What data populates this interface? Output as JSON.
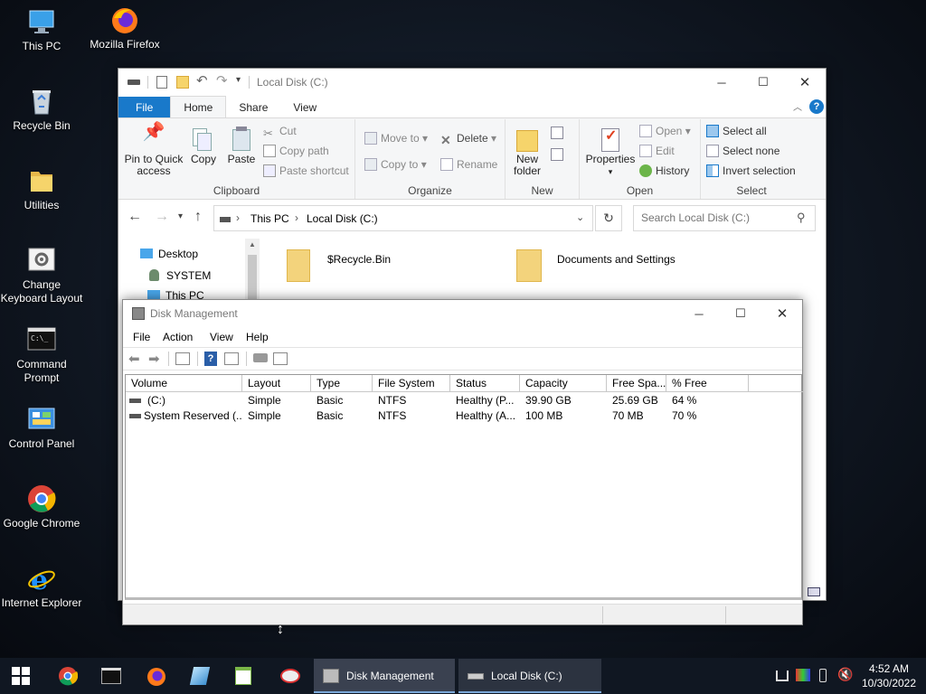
{
  "desktop_icons": [
    {
      "label": "This PC",
      "icon": "this-pc-icon"
    },
    {
      "label": "Mozilla Firefox",
      "icon": "firefox-icon"
    },
    {
      "label": "Recycle Bin",
      "icon": "recycle-bin-icon"
    },
    {
      "label": "Utilities",
      "icon": "folder-icon"
    },
    {
      "label": "Change Keyboard Layout",
      "icon": "keyboard-settings-icon"
    },
    {
      "label": "Command Prompt",
      "icon": "command-prompt-icon"
    },
    {
      "label": "Control Panel",
      "icon": "control-panel-icon"
    },
    {
      "label": "Google Chrome",
      "icon": "chrome-icon"
    },
    {
      "label": "Internet Explorer",
      "icon": "internet-explorer-icon"
    }
  ],
  "explorer": {
    "title": "Local Disk (C:)",
    "tabs": [
      "File",
      "Home",
      "Share",
      "View"
    ],
    "clipboard": {
      "pin": "Pin to Quick access",
      "copy": "Copy",
      "paste": "Paste",
      "cut": "Cut",
      "copy_path": "Copy path",
      "paste_shortcut": "Paste shortcut",
      "label": "Clipboard"
    },
    "organize": {
      "move_to": "Move to",
      "copy_to": "Copy to",
      "delete": "Delete",
      "rename": "Rename",
      "label": "Organize"
    },
    "new": {
      "new_folder": "New folder",
      "label": "New"
    },
    "open": {
      "properties": "Properties",
      "open": "Open",
      "edit": "Edit",
      "history": "History",
      "label": "Open"
    },
    "select": {
      "select_all": "Select all",
      "select_none": "Select none",
      "invert": "Invert selection",
      "label": "Select"
    },
    "breadcrumb": [
      "This PC",
      "Local Disk (C:)"
    ],
    "search_placeholder": "Search Local Disk (C:)",
    "nav_items": [
      "Desktop",
      "SYSTEM",
      "This PC"
    ],
    "files": [
      "$Recycle.Bin",
      "Documents and Settings"
    ]
  },
  "diskmgmt": {
    "title": "Disk Management",
    "menu": [
      "File",
      "Action",
      "View",
      "Help"
    ],
    "columns": [
      "Volume",
      "Layout",
      "Type",
      "File System",
      "Status",
      "Capacity",
      "Free Spa...",
      "% Free"
    ],
    "rows": [
      [
        "(C:)",
        "Simple",
        "Basic",
        "NTFS",
        "Healthy (P...",
        "39.90 GB",
        "25.69 GB",
        "64 %"
      ],
      [
        "System Reserved (...",
        "Simple",
        "Basic",
        "NTFS",
        "Healthy (A...",
        "100 MB",
        "70 MB",
        "70 %"
      ]
    ]
  },
  "taskbar": {
    "items": [
      {
        "label": "Disk Management",
        "icon": "disk-management-icon"
      },
      {
        "label": "Local Disk (C:)",
        "icon": "drive-icon"
      }
    ],
    "time": "4:52 AM",
    "date": "10/30/2022"
  },
  "colors": {
    "accent": "#1979ca",
    "taskbar": "#101722"
  }
}
